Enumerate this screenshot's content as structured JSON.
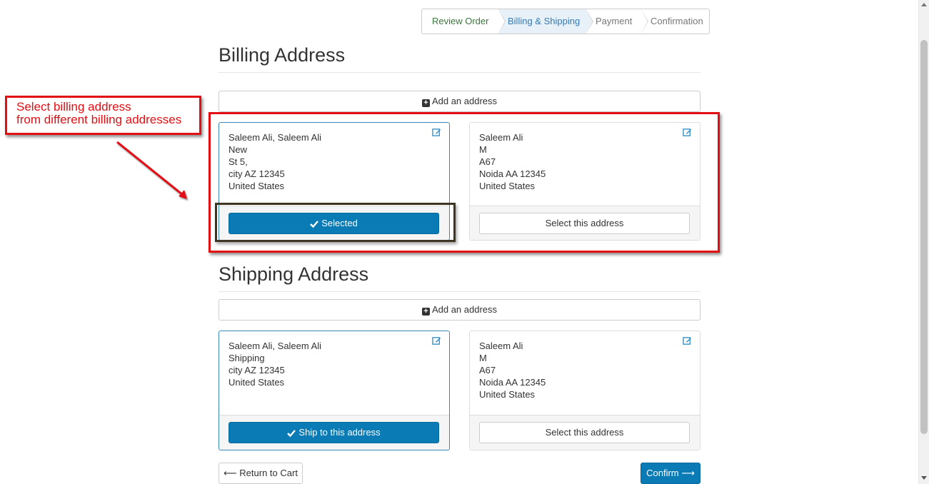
{
  "wizard": {
    "steps": [
      {
        "label": "Review Order",
        "state": "done"
      },
      {
        "label": "Billing & Shipping",
        "state": "active"
      },
      {
        "label": "Payment",
        "state": "pending"
      },
      {
        "label": "Confirmation",
        "state": "pending"
      }
    ]
  },
  "billing": {
    "title": "Billing Address",
    "add_label": "Add an address",
    "cards": [
      {
        "lines": [
          "Saleem Ali, Saleem Ali",
          "New",
          "St 5,",
          "city AZ 12345",
          "United States"
        ],
        "action": "Selected",
        "selected": true
      },
      {
        "lines": [
          "Saleem Ali",
          "M",
          "A67",
          "Noida AA 12345",
          "United States"
        ],
        "action": "Select this address",
        "selected": false
      }
    ]
  },
  "shipping": {
    "title": "Shipping Address",
    "add_label": "Add an address",
    "cards": [
      {
        "lines": [
          "Saleem Ali, Saleem Ali",
          "Shipping",
          "city AZ 12345",
          "United States"
        ],
        "action": "Ship to this address",
        "selected": true
      },
      {
        "lines": [
          "Saleem Ali",
          "M",
          "A67",
          "Noida AA 12345",
          "United States"
        ],
        "action": "Select this address",
        "selected": false
      }
    ]
  },
  "annotation": {
    "line1": "Select billing address",
    "line2": "from different billing addresses"
  },
  "footer": {
    "return_label": "Return to Cart",
    "confirm_label": "Confirm"
  },
  "colors": {
    "primary": "#0a7bb5",
    "annotation_red": "#e20f13",
    "step_done": "#3c763d",
    "step_active": "#337ab7"
  }
}
